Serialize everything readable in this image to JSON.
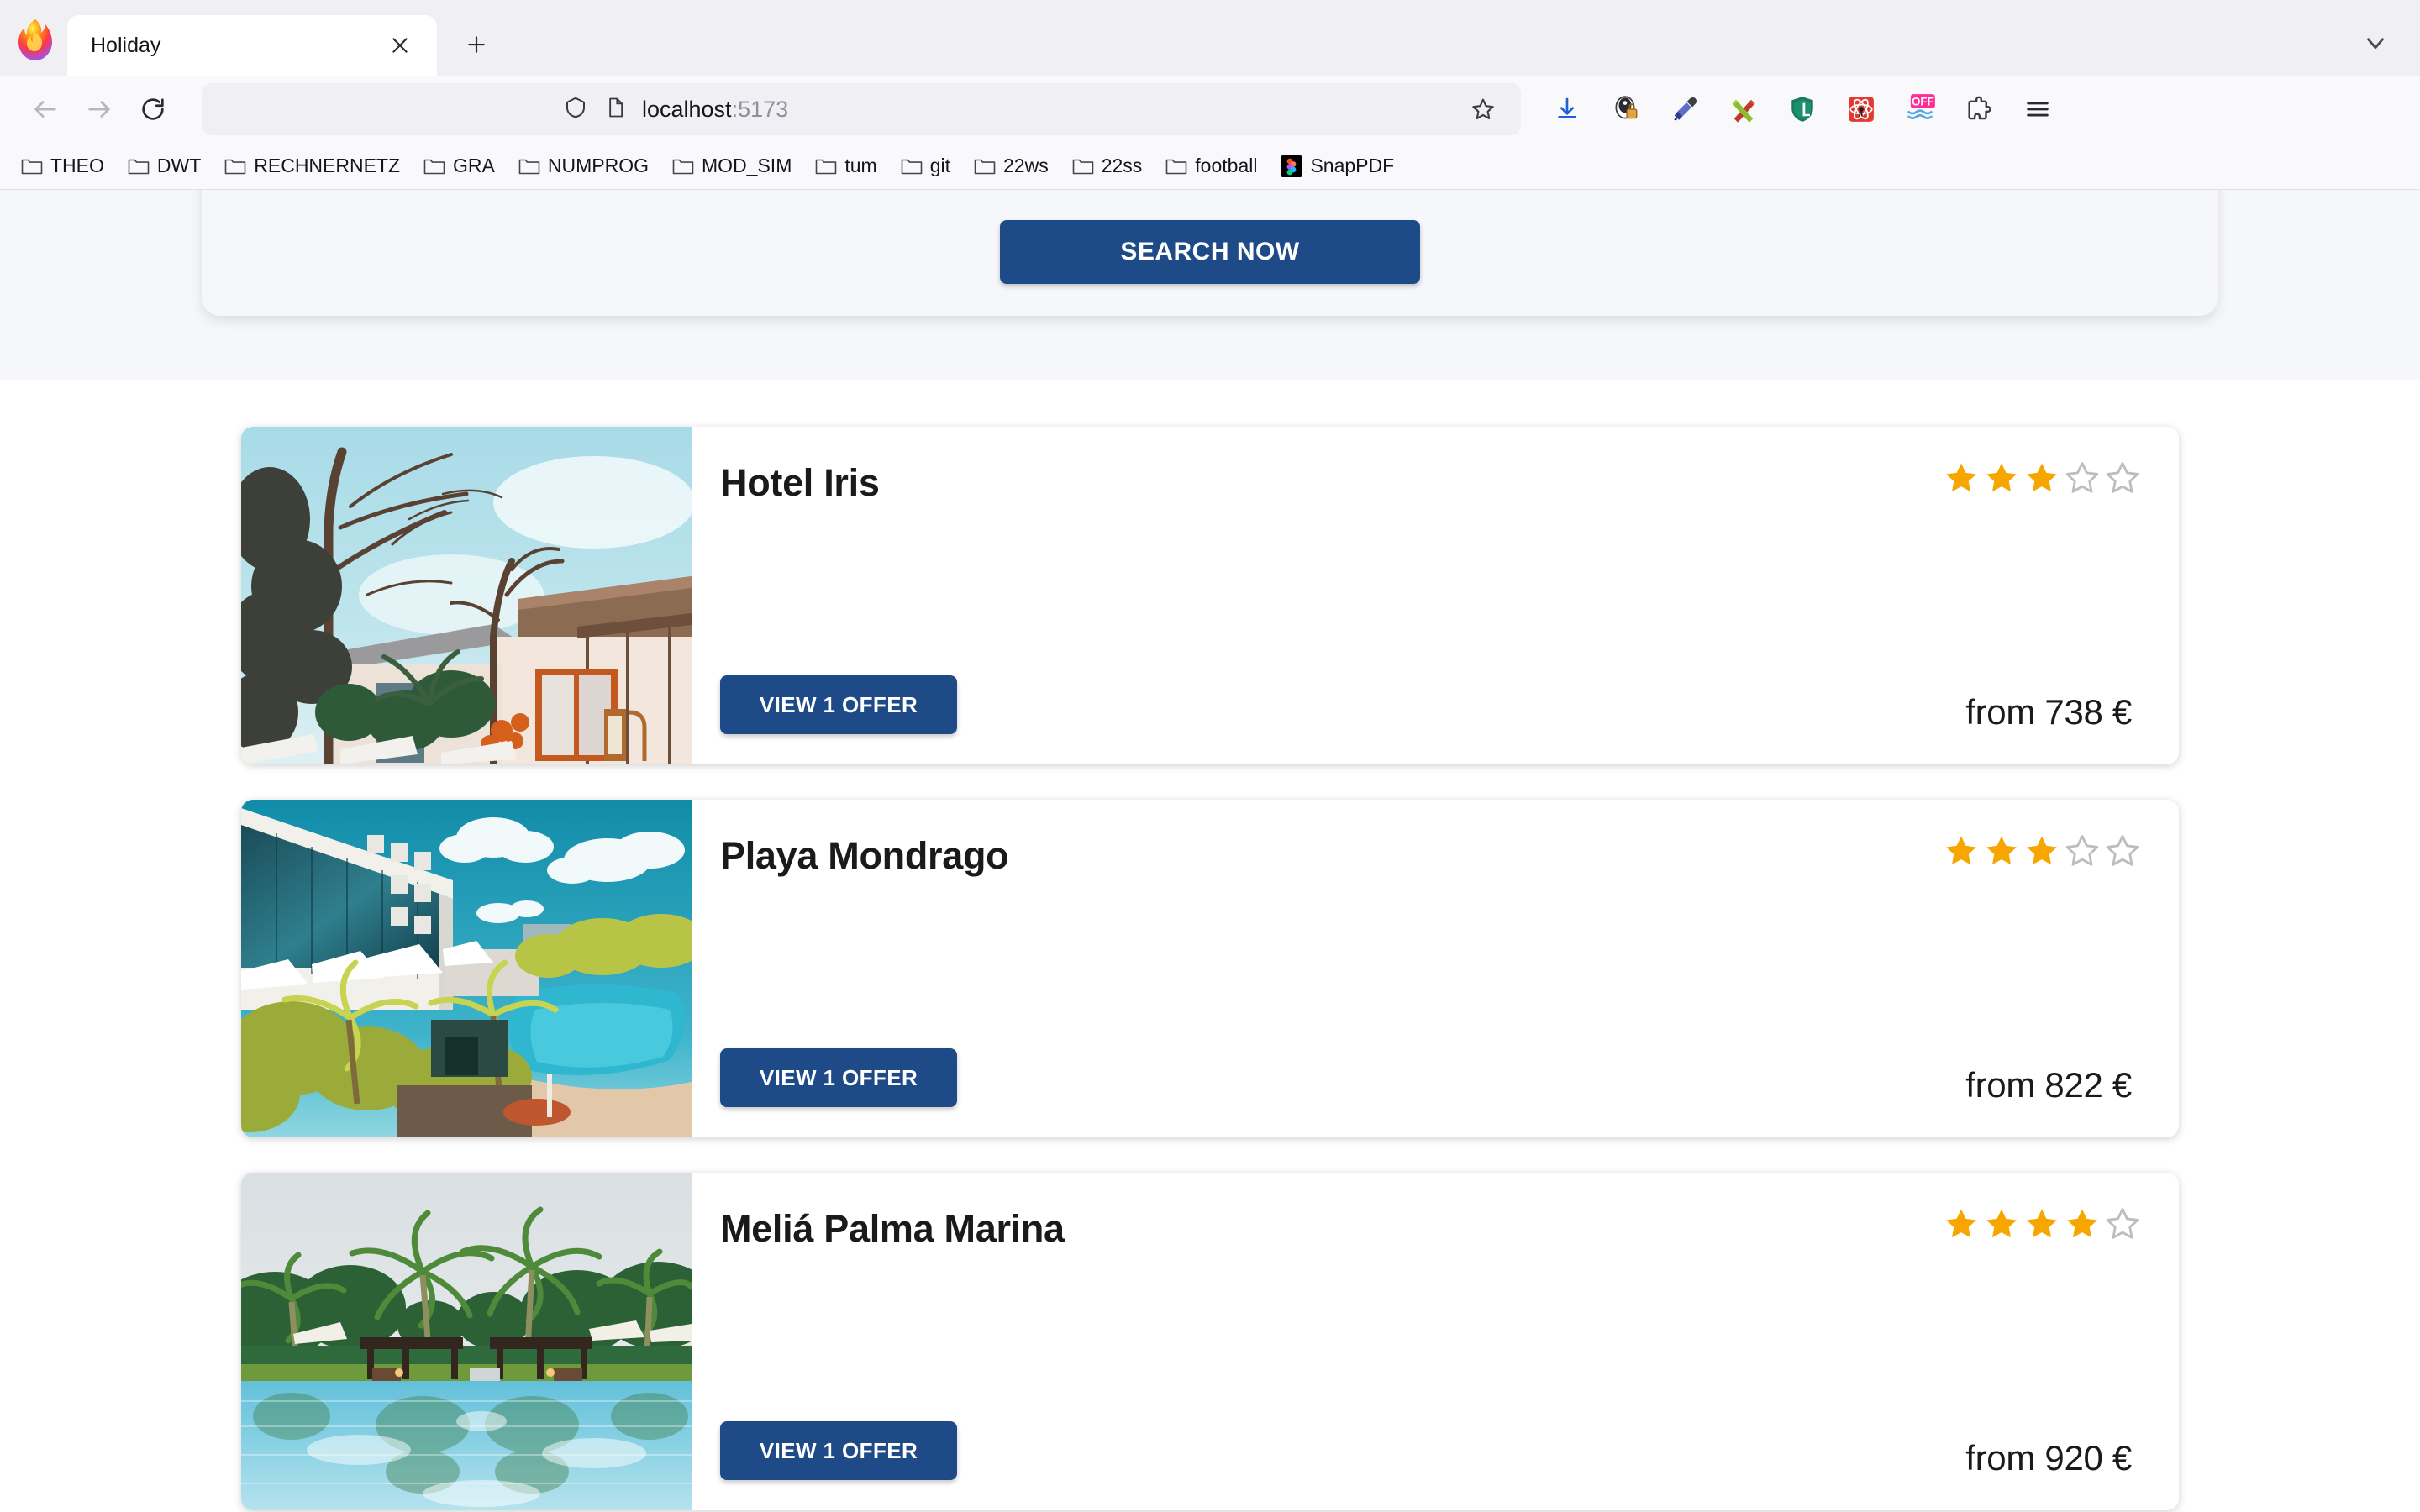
{
  "browser": {
    "tab": {
      "title": "Holiday",
      "close_label": "✕"
    },
    "new_tab_label": "+",
    "nav": {
      "back": "back-arrow",
      "forward": "forward-arrow",
      "reload": "reload"
    },
    "urlbar": {
      "host": "localhost",
      "port": ":5173",
      "shield_icon": "shield-icon",
      "page_icon": "page-icon",
      "bookmark_star": "star-outline-icon"
    },
    "toolbar_icons": [
      "downloads-icon",
      "privacy-badger-icon",
      "eyedropper-icon",
      "colorzilla-icon",
      "lastpass-icon",
      "react-devtools-icon",
      "off-toggle-icon",
      "extensions-puzzle-icon",
      "app-menu-icon"
    ],
    "bookmarks": [
      {
        "label": "THEO",
        "icon": "folder-icon"
      },
      {
        "label": "DWT",
        "icon": "folder-icon"
      },
      {
        "label": "RECHNERNETZ",
        "icon": "folder-icon"
      },
      {
        "label": "GRA",
        "icon": "folder-icon"
      },
      {
        "label": "NUMPROG",
        "icon": "folder-icon"
      },
      {
        "label": "MOD_SIM",
        "icon": "folder-icon"
      },
      {
        "label": "tum",
        "icon": "folder-icon"
      },
      {
        "label": "git",
        "icon": "folder-icon"
      },
      {
        "label": "22ws",
        "icon": "folder-icon"
      },
      {
        "label": "22ss",
        "icon": "folder-icon"
      },
      {
        "label": "football",
        "icon": "folder-icon"
      },
      {
        "label": "SnapPDF",
        "icon": "site-favicon"
      }
    ]
  },
  "page": {
    "search_panel": {
      "button_label": "SEARCH NOW"
    },
    "colors": {
      "primary_blue": "#1e4a87",
      "star_filled": "#f7a600",
      "star_empty": "#bdbdbd",
      "hero_background": "#f6f7fb",
      "card_background": "#ffffff",
      "text": "#1a1a1a"
    },
    "results": [
      {
        "name": "Hotel Iris",
        "rating": 3,
        "max_rating": 5,
        "offer_label": "VIEW 1 OFFER",
        "price": "from 738 €",
        "image_alt": "resort-villa-with-bare-trees"
      },
      {
        "name": "Playa Mondrago",
        "rating": 3,
        "max_rating": 5,
        "offer_label": "VIEW 1 OFFER",
        "price": "from 822 €",
        "image_alt": "modern-hotel-with-pool-and-palms"
      },
      {
        "name": "Meliá Palma Marina",
        "rating": 4,
        "max_rating": 5,
        "offer_label": "VIEW 1 OFFER",
        "price": "from 920 €",
        "image_alt": "infinity-pool-with-palm-reflection"
      }
    ]
  }
}
